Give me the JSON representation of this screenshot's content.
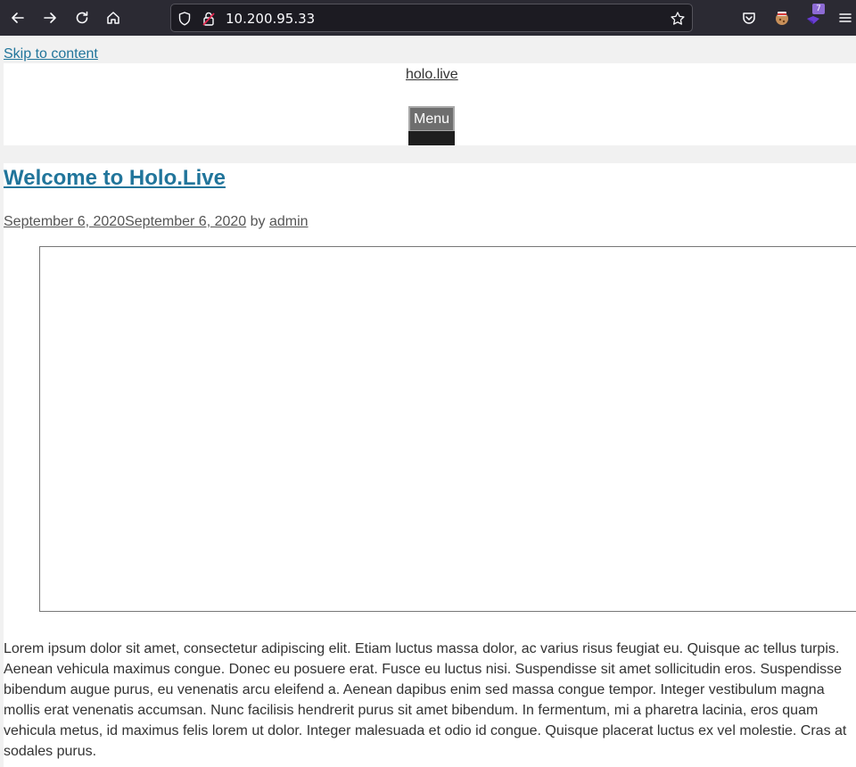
{
  "browser": {
    "url": "10.200.95.33",
    "extension_badge": "7",
    "icons": [
      "back-icon",
      "forward-icon",
      "reload-icon",
      "home-icon",
      "shield-icon",
      "lock-warning-icon",
      "star-icon",
      "pocket-icon",
      "cookie-extension-icon",
      "purple-extension-icon",
      "hamburger-menu-icon"
    ]
  },
  "page": {
    "skip_link": "Skip to content",
    "site_title": "holo.live",
    "menu_label": "Menu",
    "post": {
      "title": "Welcome to Holo.Live",
      "date_published": "September 6, 2020",
      "date_updated": "September 6, 2020",
      "by": "by",
      "author": "admin",
      "body": "Lorem ipsum dolor sit amet, consectetur adipiscing elit. Etiam luctus massa dolor, ac varius risus feugiat eu. Quisque ac tellus turpis. Aenean vehicula maximus congue. Donec eu posuere erat. Fusce eu luctus nisi. Suspendisse sit amet sollicitudin eros. Suspendisse bibendum augue purus, eu venenatis arcu eleifend a. Aenean dapibus enim sed massa congue tempor. Integer vestibulum magna mollis erat venenatis accumsan. Nunc facilisis hendrerit purus sit amet bibendum. In fermentum, mi a pharetra lacinia, eros quam vehicula metus, id maximus felis lorem ut dolor. Integer malesuada et odio id congue. Quisque placerat luctus ex vel molestie. Cras at sodales purus."
    }
  },
  "colors": {
    "toolbar_bg": "#2b2a33",
    "urlbar_bg": "#1c1b22",
    "link_blue": "#21759b",
    "band_gray": "#f1f1f1",
    "menu_bg": "#6e6e6e"
  }
}
